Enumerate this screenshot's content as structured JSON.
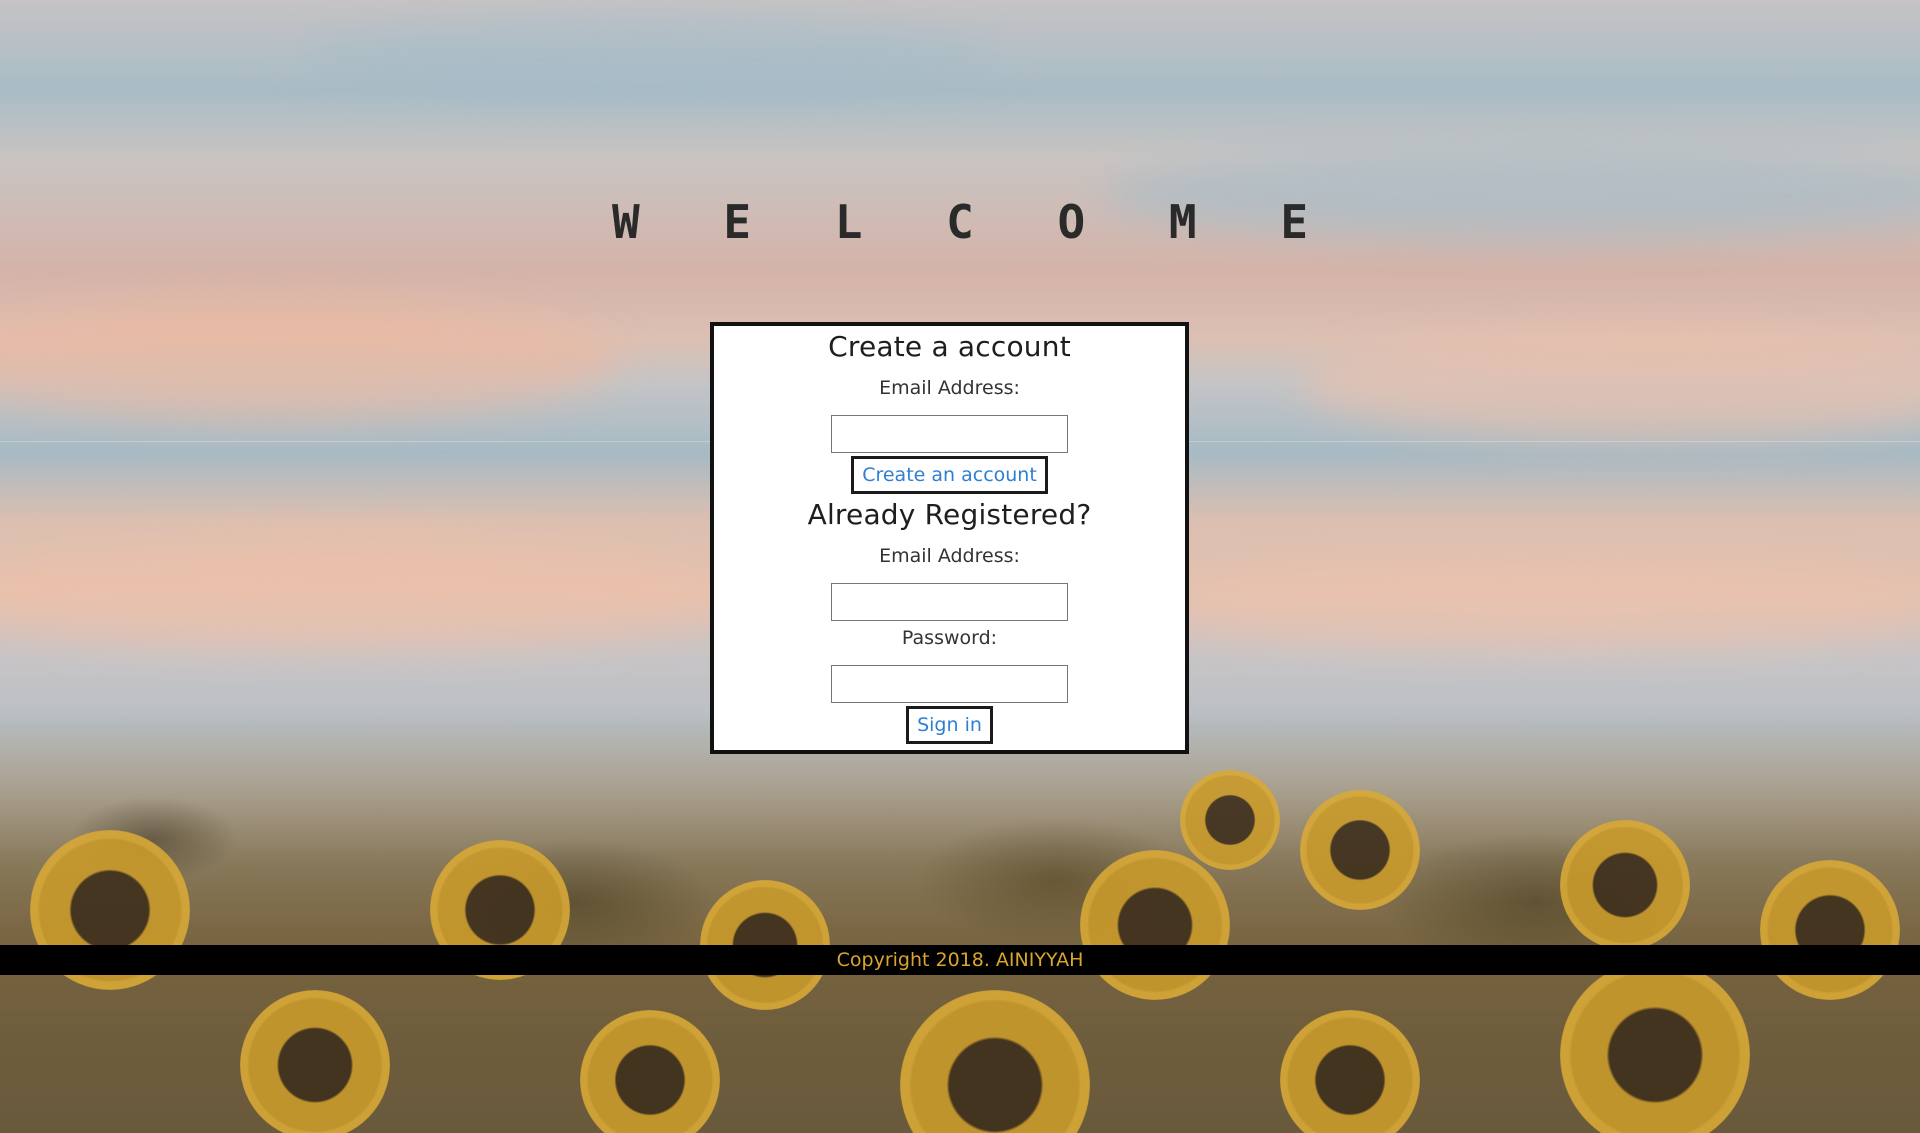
{
  "page": {
    "heading": "W E L C O M E"
  },
  "create_account": {
    "title": "Create a account",
    "email_label": "Email Address:",
    "email_value": "",
    "submit_label": "Create an account"
  },
  "sign_in": {
    "title": "Already Registered?",
    "email_label": "Email Address:",
    "email_value": "",
    "password_label": "Password:",
    "password_value": "",
    "submit_label": "Sign in"
  },
  "footer": {
    "copyright": "Copyright 2018. AINIYYAH"
  },
  "colors": {
    "link_blue": "#2f7fd1",
    "footer_text": "#d9a52c",
    "footer_bg": "#000000"
  }
}
